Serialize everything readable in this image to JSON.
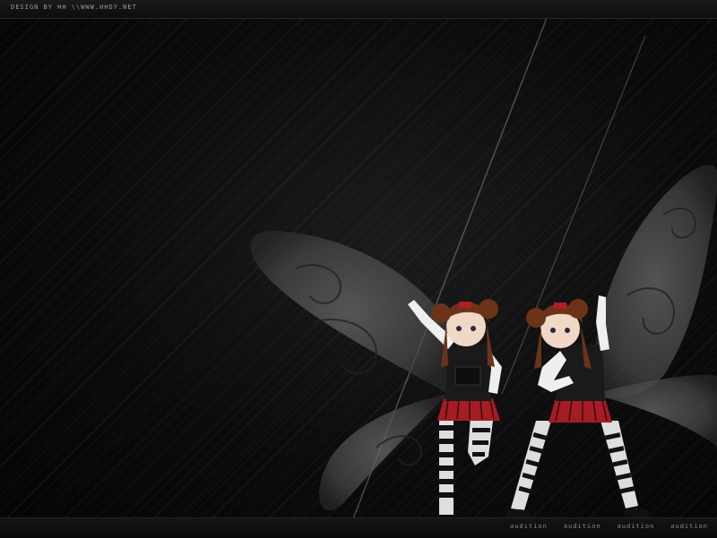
{
  "header": {
    "credit": "DESIGN BY HH \\\\WWW.HHDY.NET"
  },
  "footer": {
    "labels": [
      "audition",
      "audition",
      "audition",
      "audition"
    ]
  },
  "colors": {
    "background": "#070707",
    "wing": "#5a5a5a",
    "accent": "#b01e24"
  }
}
